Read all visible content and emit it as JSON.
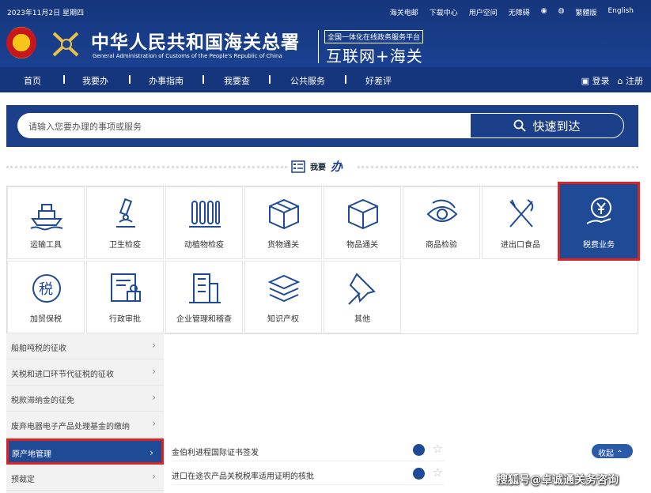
{
  "header": {
    "date": "2023年11月2日 星期四",
    "links": [
      "海关电邮",
      "下载中心",
      "用户空间",
      "无障碍",
      "微博",
      "微信",
      "繁體版",
      "English"
    ],
    "title_cn": "中华人民共和国海关总署",
    "title_en": "General Administration of Customs of the People's Republic of China",
    "slogan_small": "全国一体化在线政务服务平台",
    "slogan_big": "互联网+海关"
  },
  "nav": {
    "items": [
      "首页",
      "我要办",
      "办事指南",
      "我要查",
      "公共服务",
      "好差评"
    ],
    "login": "登录",
    "register": "注册"
  },
  "search": {
    "placeholder": "请输入您要办理的事项或服务",
    "button": "快速到达"
  },
  "section": {
    "title_small": "我要",
    "title_big": "办"
  },
  "tiles": [
    {
      "label": "运输工具",
      "icon": "ship-icon"
    },
    {
      "label": "卫生检疫",
      "icon": "microscope-icon"
    },
    {
      "label": "动植物检疫",
      "icon": "tubes-icon"
    },
    {
      "label": "货物通关",
      "icon": "box-icon"
    },
    {
      "label": "物品通关",
      "icon": "cube-icon"
    },
    {
      "label": "商品检验",
      "icon": "eye-icon"
    },
    {
      "label": "进出口食品",
      "icon": "fork-knife-icon"
    },
    {
      "label": "税费业务",
      "icon": "yen-hand-icon"
    },
    {
      "label": "加贸保税",
      "icon": "tax-icon"
    },
    {
      "label": "行政审批",
      "icon": "document-seal-icon"
    },
    {
      "label": "企业管理和稽查",
      "icon": "building-icon"
    },
    {
      "label": "知识产权",
      "icon": "books-icon"
    },
    {
      "label": "其他",
      "icon": "pin-icon"
    }
  ],
  "subitems": [
    "船舶吨税的征收",
    "关税和进口环节代征税的征收",
    "税款滞纳金的征免",
    "废弃电器电子产品处理基金的缴纳",
    "原产地管理",
    "预裁定"
  ],
  "rows": [
    "金伯利进程国际证书签发",
    "进口在途农产品关税税率适用证明的核批"
  ],
  "collapse": "收起",
  "watermark": "搜狐号@卓诚通关务咨询",
  "colors": {
    "brand": "#1a4191",
    "highlight": "#d22222"
  }
}
